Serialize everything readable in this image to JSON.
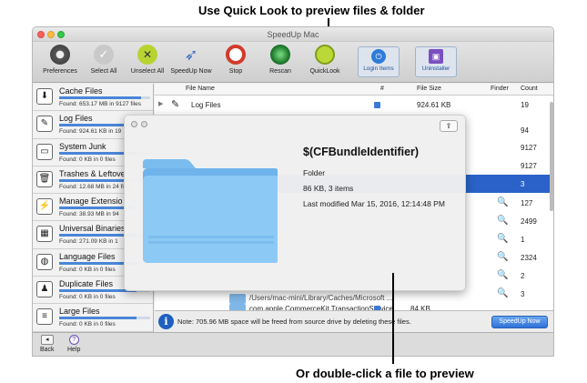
{
  "annotations": {
    "top": "Use Quick Look to preview files & folder",
    "bottom": "Or double-click a file to preview"
  },
  "window": {
    "title": "SpeedUp Mac"
  },
  "toolbar": {
    "preferences": "Preferences",
    "select_all": "Select All",
    "unselect_all": "Unselect All",
    "speedup_now": "SpeedUp Now",
    "stop": "Stop",
    "rescan": "Rescan",
    "quicklook": "QuickLook",
    "login_items": "Login Items",
    "uninstaller": "Uninstaller"
  },
  "sidebar": {
    "items": [
      {
        "title": "Cache Files",
        "found": "Found: 653.17 MB in 9127 files",
        "icon": "download-icon",
        "glyph": "⬇",
        "fill": 0.9
      },
      {
        "title": "Log Files",
        "found": "Found: 924.61 KB in 19",
        "icon": "log-icon",
        "glyph": "✎",
        "fill": 0.8
      },
      {
        "title": "System Junk",
        "found": "Found: 0  KB in 0 files",
        "icon": "monitor-icon",
        "glyph": "▭",
        "fill": 0.85
      },
      {
        "title": "Trashes & Leftove",
        "found": "Found: 12.68 MB in 24 files",
        "icon": "trash-icon",
        "glyph": "🗑",
        "fill": 0.75
      },
      {
        "title": "Manage Extensio",
        "found": "Found: 38.93 MB in 94",
        "icon": "plug-icon",
        "glyph": "⚡",
        "fill": 0.8
      },
      {
        "title": "Universal Binaries",
        "found": "Found: 271.09 KB in 1",
        "icon": "chip-icon",
        "glyph": "▦",
        "fill": 0.85
      },
      {
        "title": "Language Files",
        "found": "Found: 0  KB in 0 files",
        "icon": "globe-icon",
        "glyph": "◍",
        "fill": 0.85
      },
      {
        "title": "Duplicate Files",
        "found": "Found: 0  KB in 0 files",
        "icon": "people-icon",
        "glyph": "♟",
        "fill": 0.85
      },
      {
        "title": "Large Files",
        "found": "Found: 0  KB in 0 files",
        "icon": "document-icon",
        "glyph": "≡",
        "fill": 0.85
      }
    ]
  },
  "table": {
    "headers": {
      "file_name": "File Name",
      "num": "#",
      "file_size": "File Size",
      "finder": "Finder",
      "count": "Count"
    },
    "first_row": {
      "name": "Log Files",
      "size": "924.61 KB",
      "count": "19"
    },
    "counts": [
      "94",
      "9127",
      "9127",
      "3",
      "127",
      "2499",
      "1",
      "2324",
      "2",
      "3"
    ],
    "path_row": "/Users/mac-mini/Library/Caches/Microsoft ...",
    "last_row": {
      "name": "com.apple.CommerceKit.TransactionService",
      "size": "84  KB"
    }
  },
  "note": "Note: 705.96 MB space will be freed from source drive by deleting these files.",
  "speedup_button": "SpeedUp Now",
  "footer": {
    "back": "Back",
    "help": "Help"
  },
  "quicklook": {
    "title": "$(CFBundleIdentifier)",
    "kind": "Folder",
    "size": "86 KB, 3 items",
    "modified": "Last modified Mar 15, 2016, 12:14:48 PM"
  }
}
